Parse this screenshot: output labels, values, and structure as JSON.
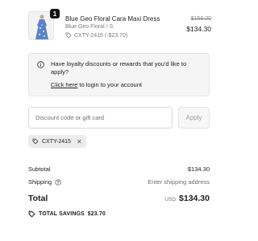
{
  "line_item": {
    "quantity": "1",
    "title": "Blue Geo Floral Cara Maxi Dress",
    "variant": "Blue Geo Floral / S",
    "discount_code": "CXTY-2415 (-$23.70)",
    "compare_price": "$158.00",
    "final_price": "$134.30"
  },
  "loyalty": {
    "message": "Have loyalty discounts or rewards that you'd like to apply?",
    "login_link": "Click here",
    "login_suffix": " to login to your account"
  },
  "discount": {
    "placeholder": "Discount code or gift card",
    "apply_label": "Apply",
    "applied_code": "CXTY-2415"
  },
  "summary": {
    "subtotal_label": "Subtotal",
    "subtotal_value": "$134.30",
    "shipping_label": "Shipping",
    "shipping_value": "Enter shipping address",
    "total_label": "Total",
    "currency": "USD",
    "total_value": "$134.30",
    "savings_label": "TOTAL SAVINGS",
    "savings_value": "$23.70"
  },
  "icons": {
    "info": "info-icon",
    "help": "help-circle-icon",
    "tag": "tag-icon",
    "close": "close-icon"
  },
  "colors": {
    "text": "#1f1f1f",
    "muted": "#6f6f6f",
    "panel": "#f5f5f5",
    "badge": "#111111",
    "dress_blue": "#5b82c4"
  }
}
